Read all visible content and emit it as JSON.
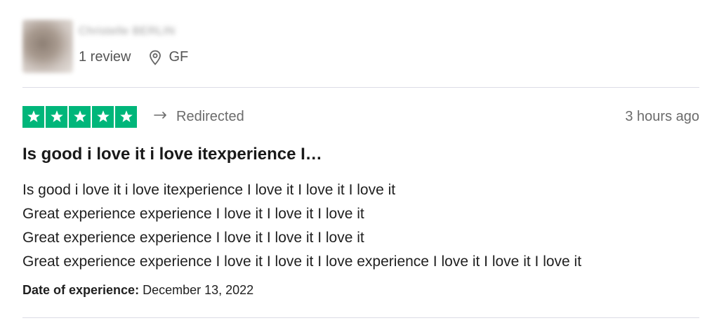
{
  "reviewer": {
    "name": "Christelle BERLIN",
    "review_count": "1 review",
    "location": "GF"
  },
  "rating": {
    "stars": 5,
    "max_stars": 5,
    "star_color": "#00b67a",
    "status": "Redirected",
    "time_ago": "3 hours ago"
  },
  "review": {
    "title": "Is good i love it i love itexperience I…",
    "lines": [
      "Is good i love it i love itexperience I love it I love it I love it",
      "Great experience experience I love it I love it I love it",
      "Great experience experience I love it I love it I love it",
      "Great experience experience I love it I love it I love experience I love it I love it I love it"
    ],
    "date_label": "Date of experience:",
    "date_value": "December 13, 2022"
  },
  "icons": {
    "location": "location-pin-icon",
    "redirect": "redirect-arrow-icon",
    "star": "star-icon"
  }
}
